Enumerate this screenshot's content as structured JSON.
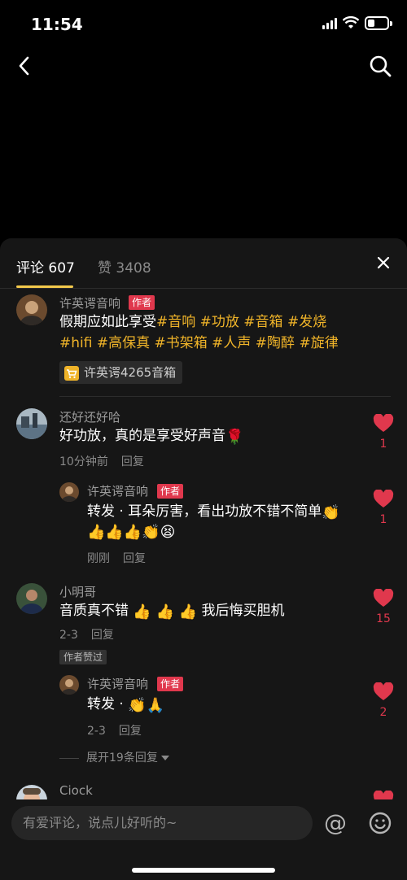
{
  "status": {
    "time": "11:54"
  },
  "tabs": {
    "comments": "评论 607",
    "likes": "赞 3408"
  },
  "comments": [
    {
      "user": "许英谔音响",
      "tag": "作者",
      "text_line1": "假期应如此享受",
      "hashtags1": "#音响 #功放 #音箱 #发烧",
      "hashtags2": "#hifi #高保真 #书架箱 #人声 #陶醉 #旋律",
      "shop": "许英谔4265音箱"
    },
    {
      "user": "还好还好哈",
      "text": "好功放，真的是享受好声音",
      "emoji": "🌹",
      "time": "10分钟前",
      "reply_label": "回复",
      "likes": "1",
      "reply": {
        "user": "许英谔音响",
        "tag": "作者",
        "text_line1": "转发 · 耳朵厉害，看出功放不错不简单",
        "emoji1": "👏",
        "emoji_line2": "👍👍👍👏😫",
        "time": "刚刚",
        "reply_label": "回复",
        "likes": "1"
      }
    },
    {
      "user": "小明哥",
      "text_a": "音质真不错",
      "emoji": "👍 👍 👍",
      "text_b": "我后悔买胆机",
      "time": "2-3",
      "reply_label": "回复",
      "likes": "15",
      "praise": "作者赞过",
      "reply": {
        "user": "许英谔音响",
        "tag": "作者",
        "text": "转发 ·",
        "emoji": "👏🙏",
        "time": "2-3",
        "reply_label": "回复",
        "likes": "2"
      },
      "expand": "展开19条回复"
    },
    {
      "user": "Ciock"
    }
  ],
  "input": {
    "placeholder": "有爱评论，说点儿好听的~"
  },
  "colors": {
    "accent": "#f0b429",
    "like": "#e0384d",
    "tag": "#e0384d",
    "sheet": "#161616"
  }
}
